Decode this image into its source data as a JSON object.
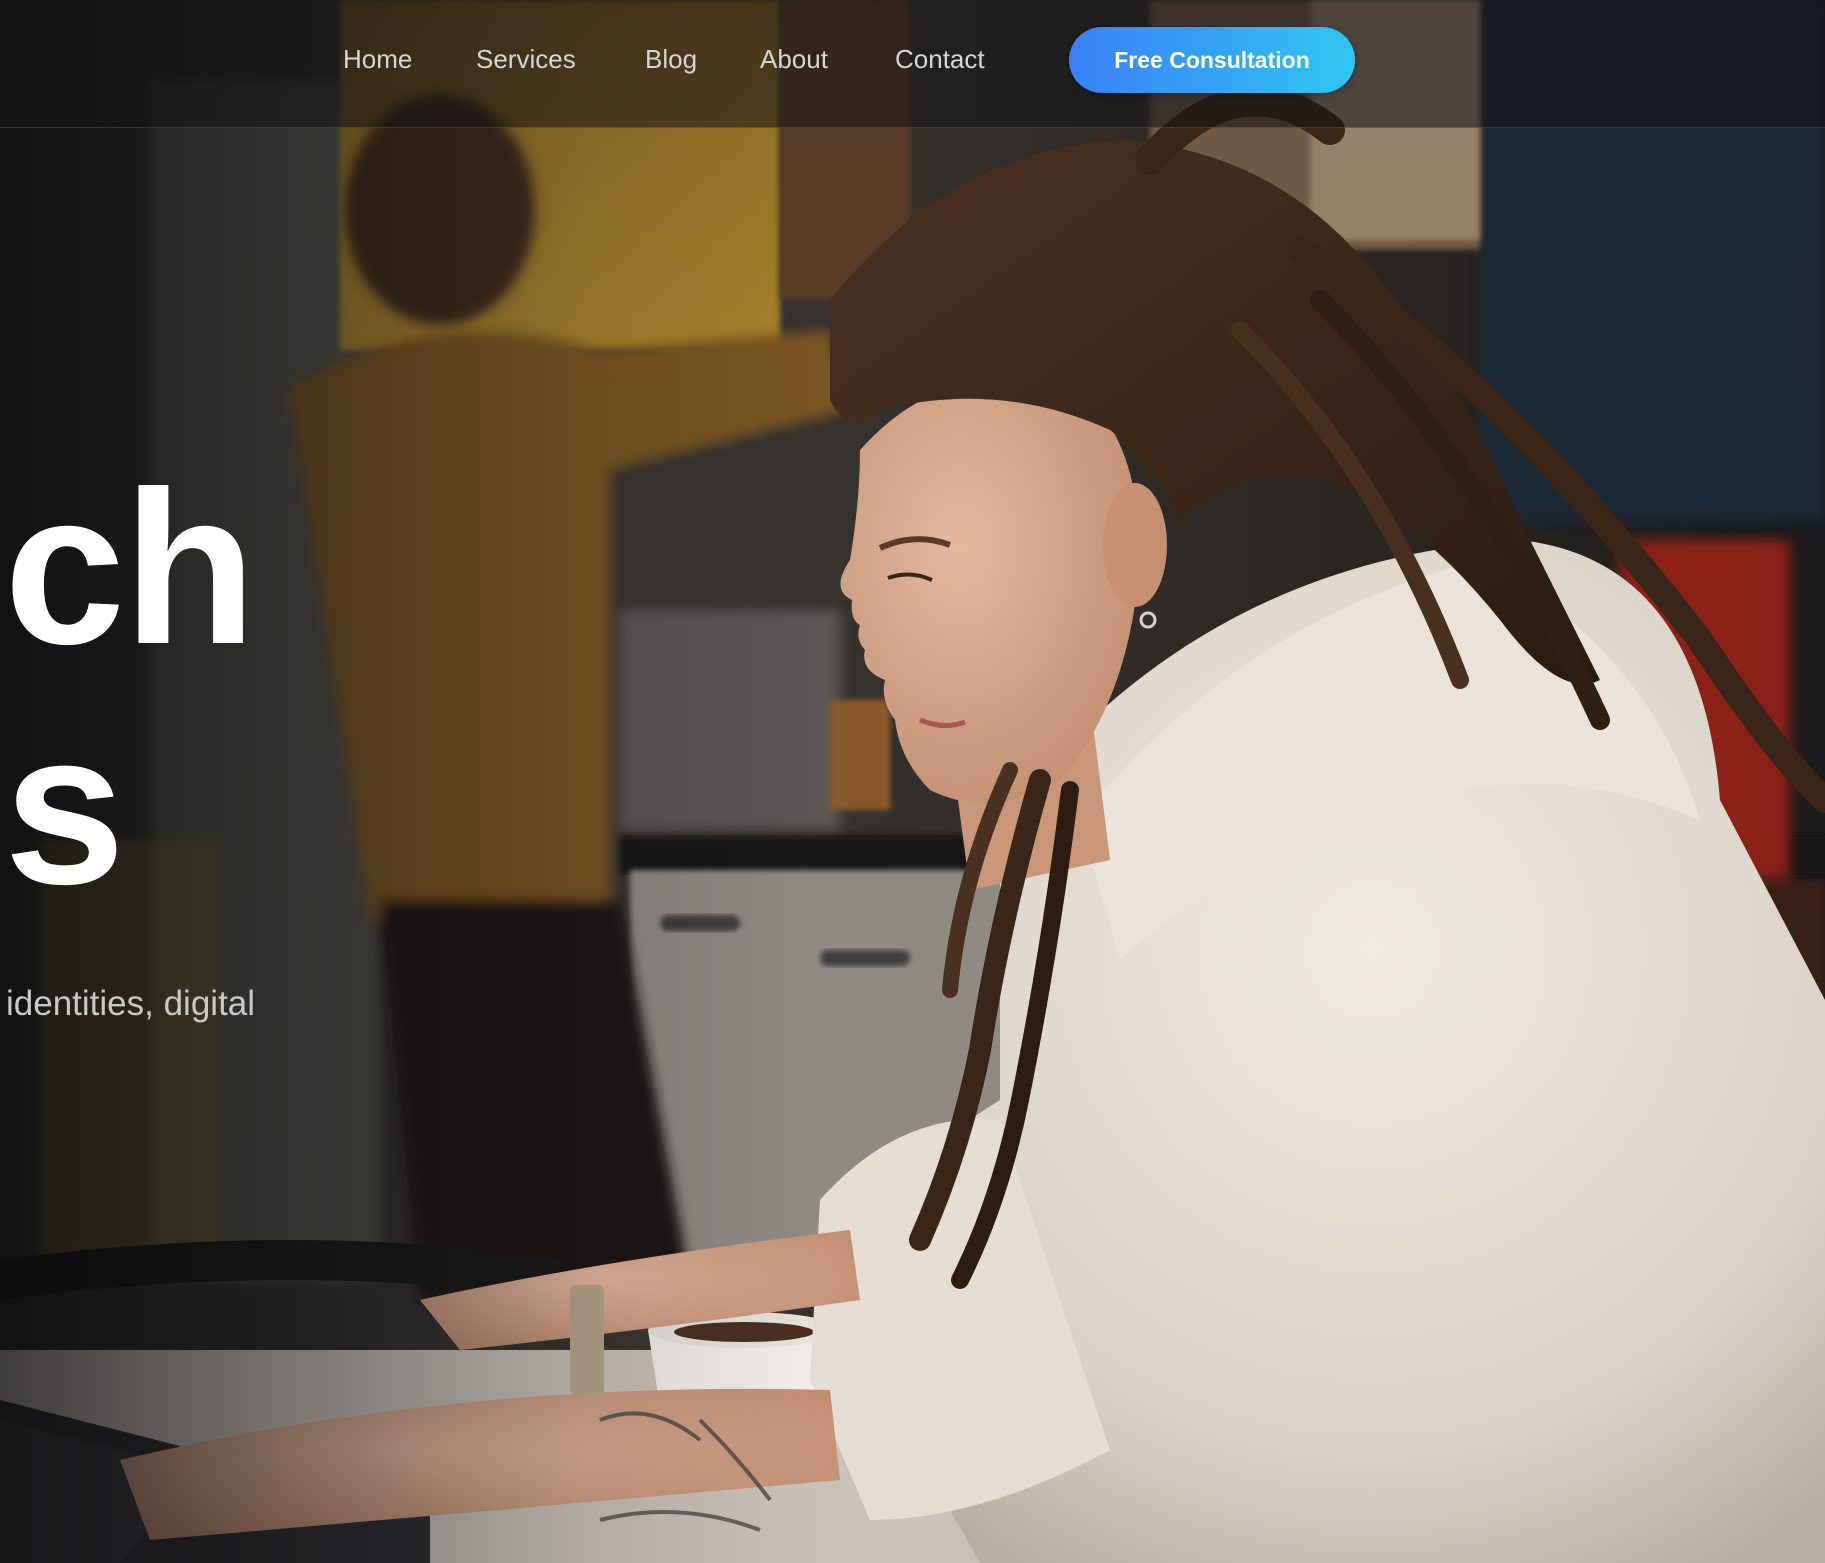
{
  "nav": {
    "links": [
      "Home",
      "Services",
      "Blog",
      "About",
      "Contact"
    ],
    "cta_label": "Free Consultation"
  },
  "hero": {
    "headline_line1": "ch",
    "headline_line2": "s",
    "subtext": "identities, digital"
  },
  "colors": {
    "accent_start": "#3b7ff7",
    "accent_end": "#2fc7f0",
    "nav_text": "#d6d6d6",
    "headline": "#ffffff"
  }
}
